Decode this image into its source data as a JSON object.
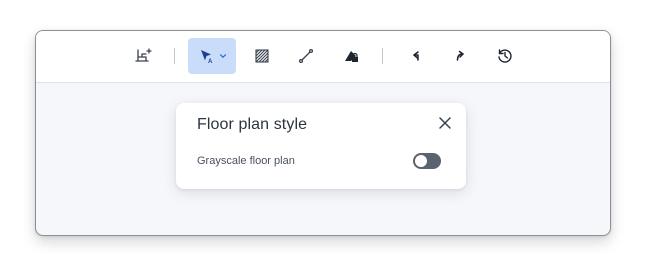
{
  "toolbar": {
    "tools": [
      {
        "name": "add-furniture",
        "icon": "chair-plus-icon",
        "active": false
      },
      {
        "name": "select",
        "icon": "cursor-arrow-icon",
        "active": true
      },
      {
        "name": "hatch",
        "icon": "hatch-square-icon",
        "active": false
      },
      {
        "name": "line",
        "icon": "line-segment-icon",
        "active": false
      },
      {
        "name": "fill",
        "icon": "paint-bucket-icon",
        "active": false
      },
      {
        "name": "undo",
        "icon": "undo-arrow-icon",
        "active": false
      },
      {
        "name": "redo",
        "icon": "redo-arrow-icon",
        "active": false
      },
      {
        "name": "history",
        "icon": "history-clock-icon",
        "active": false
      }
    ],
    "active_color": "#c9ddfb",
    "accent_color": "#2f63d6"
  },
  "popover": {
    "title": "Floor plan style",
    "option_label": "Grayscale floor plan",
    "toggle_on": false
  }
}
